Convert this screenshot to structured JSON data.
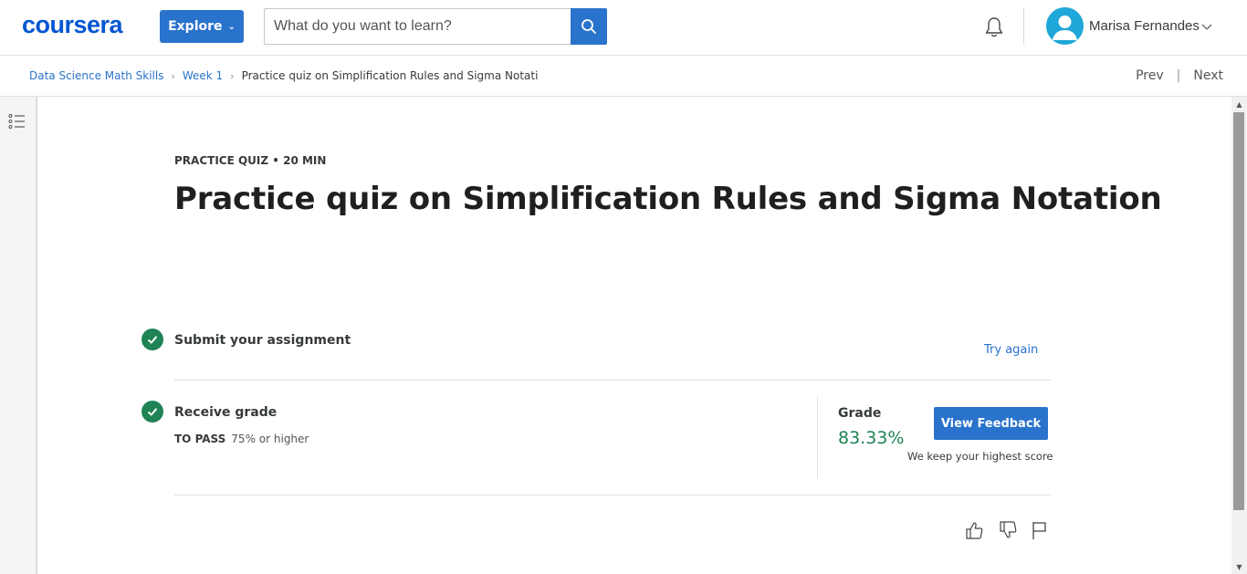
{
  "brand": {
    "logo_text": "coursera",
    "accent": "#2a73cc",
    "success": "#1f8354"
  },
  "topnav": {
    "explore_label": "Explore",
    "search_placeholder": "What do you want to learn?",
    "user_name": "Marisa Fernandes",
    "icons": [
      "search-icon",
      "bell-icon",
      "avatar-icon",
      "chevron-down-icon"
    ]
  },
  "breadcrumb": {
    "items": [
      "Data Science Math Skills",
      "Week 1",
      "Practice quiz on Simplification Rules and Sigma Notati"
    ],
    "prev_label": "Prev",
    "next_label": "Next"
  },
  "main": {
    "kicker": "PRACTICE QUIZ • 20 MIN",
    "title": "Practice quiz on Simplification Rules and Sigma Notation",
    "step_submit": {
      "title": "Submit your assignment",
      "action": "Try again"
    },
    "step_grade": {
      "title": "Receive grade",
      "to_pass_label": "TO PASS",
      "to_pass_value": "75% or higher",
      "grade_label": "Grade",
      "grade_value": "83.33%",
      "feedback_button": "View Feedback",
      "note": "We keep your highest score"
    },
    "feedback_icons": [
      "thumbs-up-icon",
      "thumbs-down-icon",
      "flag-icon"
    ]
  }
}
